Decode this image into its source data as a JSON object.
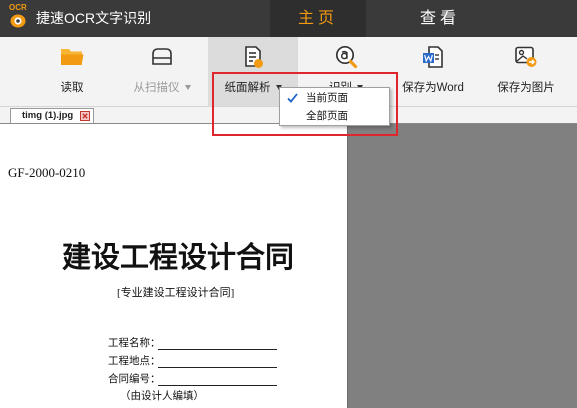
{
  "app": {
    "logo_text": "OCR",
    "title": "捷速OCR文字识别"
  },
  "nav": {
    "tabs": [
      {
        "label": "主页",
        "active": true
      },
      {
        "label": "查看",
        "active": false
      }
    ]
  },
  "toolbar": {
    "buttons": [
      {
        "label": "读取",
        "icon": "folder-icon",
        "has_dropdown": false,
        "enabled": true
      },
      {
        "label": "从扫描仪",
        "icon": "scanner-icon",
        "has_dropdown": true,
        "enabled": false
      },
      {
        "label": "纸面解析",
        "icon": "page-analysis-icon",
        "has_dropdown": true,
        "enabled": true,
        "active": true
      },
      {
        "label": "识别",
        "icon": "recognize-icon",
        "has_dropdown": true,
        "enabled": true
      },
      {
        "label": "保存为Word",
        "icon": "word-icon",
        "has_dropdown": false,
        "enabled": true
      },
      {
        "label": "保存为图片",
        "icon": "image-icon",
        "has_dropdown": false,
        "enabled": true
      }
    ]
  },
  "dropdown": {
    "items": [
      {
        "label": "当前页面",
        "checked": true
      },
      {
        "label": "全部页面",
        "checked": false
      }
    ]
  },
  "document_tabs": [
    {
      "label": "timg (1).jpg",
      "icon": "close-icon"
    }
  ],
  "document": {
    "code": "GF-2000-0210",
    "title": "建设工程设计合同",
    "subtitle": "[专业建设工程设计合同]",
    "fields": [
      {
        "label": "工程名称："
      },
      {
        "label": "工程地点："
      },
      {
        "label": "合同编号："
      }
    ],
    "note": "（由设计人编填）"
  },
  "colors": {
    "accent": "#f29a12",
    "annotation": "#e0262a",
    "check": "#1a64c8",
    "titlebar": "#3a3a3a",
    "workspace": "#808080"
  }
}
